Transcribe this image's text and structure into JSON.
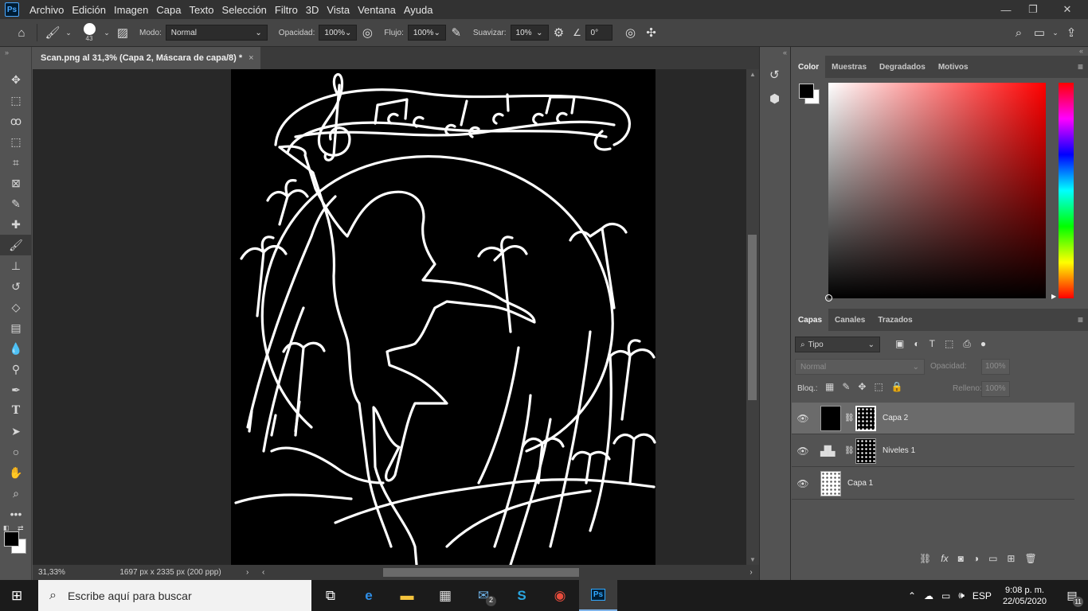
{
  "app": {
    "logo_text": "Ps",
    "accent": "#31a8ff"
  },
  "menu": [
    "Archivo",
    "Edición",
    "Imagen",
    "Capa",
    "Texto",
    "Selección",
    "Filtro",
    "3D",
    "Vista",
    "Ventana",
    "Ayuda"
  ],
  "window_controls": {
    "minimize": "—",
    "restore": "❐",
    "close": "✕"
  },
  "options": {
    "brush_size": "43",
    "mode_label": "Modo:",
    "mode_value": "Normal",
    "opacity_label": "Opacidad:",
    "opacity_value": "100%",
    "flow_label": "Flujo:",
    "flow_value": "100%",
    "smooth_label": "Suavizar:",
    "smooth_value": "10%",
    "angle_value": "0°"
  },
  "document": {
    "tab_title": "Scan.png al 31,3% (Capa 2, Máscara de capa/8) *",
    "tab_close": "×",
    "zoom": "31,33%",
    "doc_info": "1697 px x 2335 px (200 ppp)"
  },
  "color_panel": {
    "tabs": [
      "Color",
      "Muestras",
      "Degradados",
      "Motivos"
    ],
    "active_tab": "Color",
    "picker_hue": "#ff0000",
    "foreground": "#000000",
    "background": "#ffffff"
  },
  "layers_panel": {
    "tabs": [
      "Capas",
      "Canales",
      "Trazados"
    ],
    "active_tab": "Capas",
    "filter_kind": "Tipo",
    "blend_mode": "Normal",
    "opacity_label": "Opacidad:",
    "opacity_value": "100%",
    "lock_label": "Bloq.:",
    "fill_label": "Relleno:",
    "fill_value": "100%",
    "layers": [
      {
        "name": "Capa 2",
        "selected": true
      },
      {
        "name": "Niveles 1",
        "selected": false
      },
      {
        "name": "Capa 1",
        "selected": false
      }
    ],
    "footer_icons": [
      "link-icon",
      "fx-icon",
      "mask-icon",
      "adjustment-icon",
      "folder-icon",
      "new-layer-icon",
      "trash-icon"
    ]
  },
  "taskbar": {
    "search_placeholder": "Escribe aquí para buscar",
    "language": "ESP",
    "time": "9:08 p. m.",
    "date": "22/05/2020",
    "mail_badge": "2",
    "notif_badge": "11"
  }
}
